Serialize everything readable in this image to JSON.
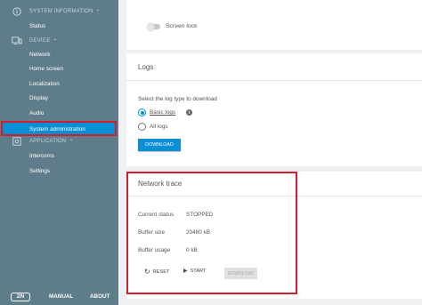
{
  "sidebar": {
    "system_information": "SYSTEM INFORMATION",
    "status": "Status",
    "device": "DEVICE",
    "device_items": [
      "Network",
      "Home screen",
      "Localization",
      "Display",
      "Audio",
      "System administration"
    ],
    "application": "APPLICATION",
    "application_items": [
      "Intercoms",
      "Settings"
    ],
    "footer": {
      "logo": "2N",
      "manual": "MANUAL",
      "about": "ABOUT"
    }
  },
  "screen_lock": {
    "label": "Screen lock",
    "enabled": false
  },
  "logs": {
    "title": "Logs",
    "prompt": "Select the log type to download",
    "options": [
      "Basic logs",
      "All logs"
    ],
    "selected": "Basic logs",
    "download_label": "DOWNLOAD"
  },
  "network_trace": {
    "title": "Network trace",
    "rows": [
      {
        "label": "Current status",
        "value": "STOPPED"
      },
      {
        "label": "Buffer size",
        "value": "20480 kB"
      },
      {
        "label": "Buffer usage",
        "value": "0 kB"
      }
    ],
    "reset_label": "RESET",
    "start_label": "START",
    "download_label": "DOWNLOAD"
  },
  "colors": {
    "sidebar": "#5f7c8a",
    "accent": "#0a8ed6",
    "highlight": "#d01f2a"
  }
}
